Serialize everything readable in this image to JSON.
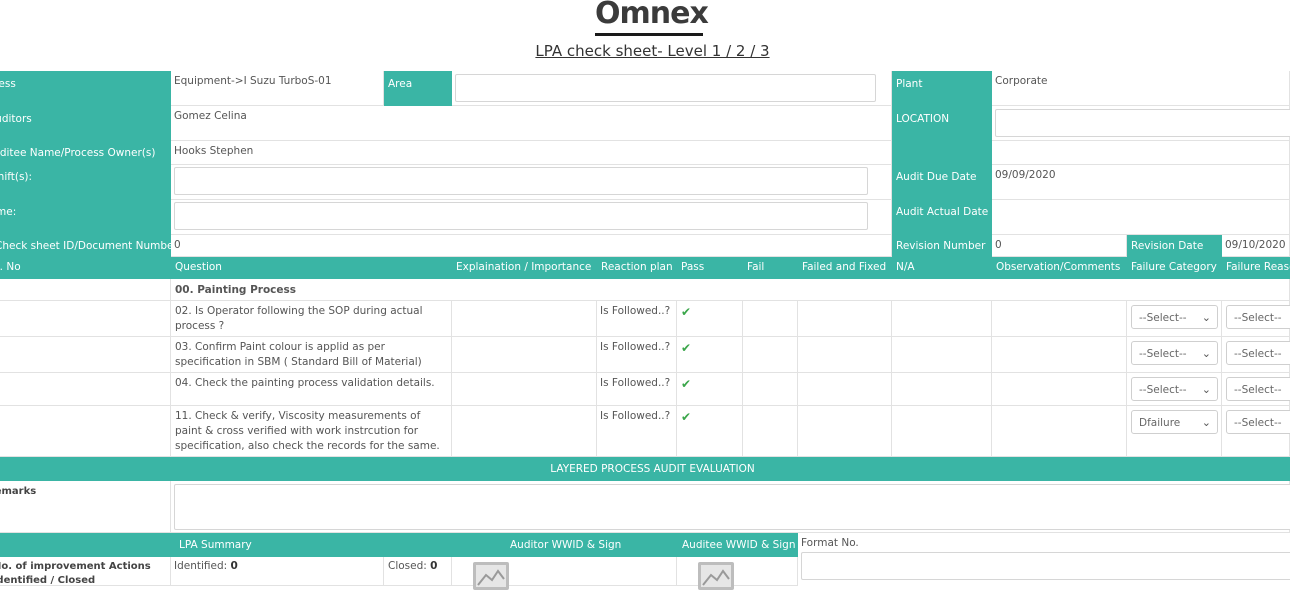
{
  "logo": {
    "text": "Omnex"
  },
  "title": "LPA check sheet- Level 1 / 2 / 3",
  "info": {
    "process_label": "Process",
    "process_value": "Equipment->I Suzu TurboS-01",
    "area_label": "Area",
    "plant_label": "Plant",
    "plant_value": "Corporate",
    "auditors_label": "Auditors",
    "auditors_value": "Gomez Celina",
    "location_label": "LOCATION",
    "auditee_label": "Auditee Name/Process Owner(s)",
    "auditee_value": "Hooks Stephen",
    "shift_label": "Shift(s):",
    "audit_due_label": "Audit Due Date",
    "audit_due_value": "09/09/2020",
    "time_label": "Time:",
    "audit_actual_label": "Audit Actual Date",
    "docnum_label": "Check sheet ID/Document Number",
    "docnum_value": "0",
    "revision_number_label": "Revision Number",
    "revision_number_value": "0",
    "revision_date_label": "Revision Date",
    "revision_date_value": "09/10/2020"
  },
  "columns": {
    "no": "S. No",
    "question": "Question",
    "explanation": "Explaination / Importance",
    "reaction": "Reaction plan",
    "pass": "Pass",
    "fail": "Fail",
    "failed_fixed": "Failed and Fixed",
    "na": "N/A",
    "observation": "Observation/Comments",
    "failure_category": "Failure Category",
    "failure_reason": "Failure Reason"
  },
  "section_title": "00. Painting Process",
  "rows": [
    {
      "question": "02. Is Operator following the SOP during actual process ?",
      "reaction": "Is Followed..?",
      "category": "--Select--",
      "reason": "--Select--"
    },
    {
      "question": "03. Confirm Paint colour is applid as per specification in SBM ( Standard Bill of Material)",
      "reaction": "Is Followed..?",
      "category": "--Select--",
      "reason": "--Select--"
    },
    {
      "question": "04. Check the painting process validation details.",
      "reaction": "Is Followed..?",
      "category": "--Select--",
      "reason": "--Select--"
    },
    {
      "question": "11. Check & verify, Viscosity measurements of paint & cross verified with work instrcution for specification, also check the records for the same.",
      "reaction": "Is Followed..?",
      "category": "Dfailure",
      "reason": "--Select--"
    }
  ],
  "evaluation": {
    "title": "LAYERED PROCESS AUDIT EVALUATION",
    "remarks_label": "Remarks"
  },
  "summary": {
    "lpa_summary": "LPA Summary",
    "auditor_sign": "Auditor WWID & Sign",
    "auditee_sign": "Auditee WWID & Sign",
    "format_label": "Format No.",
    "actions_label": "No. of improvement Actions identified / Closed",
    "identified_label": "Identified:",
    "identified_value": "0",
    "closed_label": "Closed:",
    "closed_value": "0"
  },
  "colors": {
    "teal": "#3ab5a5",
    "check": "#3aa64a"
  }
}
